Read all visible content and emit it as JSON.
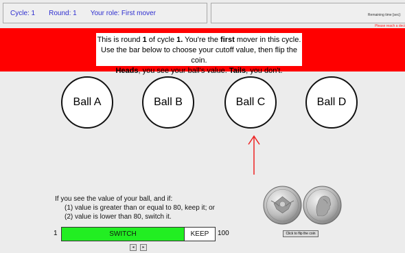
{
  "header": {
    "cycle": "Cycle: 1",
    "round": "Round: 1",
    "role": "Your role: First mover",
    "remaining_label": "Remaining time [sec]:",
    "warning": "Please reach a deci"
  },
  "instructions": {
    "line1_pre": "This is round ",
    "line1_round": "1",
    "line1_mid": " of cycle ",
    "line1_cycle": "1.",
    "line1_mid2": " You're the ",
    "line1_first": "first",
    "line1_post": " mover in this cycle.",
    "line2": "Use the bar below to choose your cutoff value, then flip the coin.",
    "line3_heads": "Heads",
    "line3_mid": ", you see your ball's value. ",
    "line3_tails": "Tails",
    "line3_post": ", you don't."
  },
  "balls": [
    "Ball A",
    "Ball B",
    "Ball C",
    "Ball D"
  ],
  "selected_ball": "Ball C",
  "rule": {
    "intro": "If you see the value of your ball, and if:",
    "item1": "(1) value is greater than or equal to 80, keep it; or",
    "item2": "(2) value is lower than 80, switch it."
  },
  "cutoff": {
    "min": "1",
    "max": "100",
    "value": 80,
    "switch_label": "SWITCH",
    "keep_label": "KEEP"
  },
  "nav": {
    "left": "◂",
    "right": "▸"
  },
  "coin": {
    "flip_label": "Click to flip the coin"
  },
  "colors": {
    "banner": "#ff0000",
    "header_text": "#2c2ccf",
    "switch_fill": "#22ee22",
    "arrow": "#ee2222"
  }
}
